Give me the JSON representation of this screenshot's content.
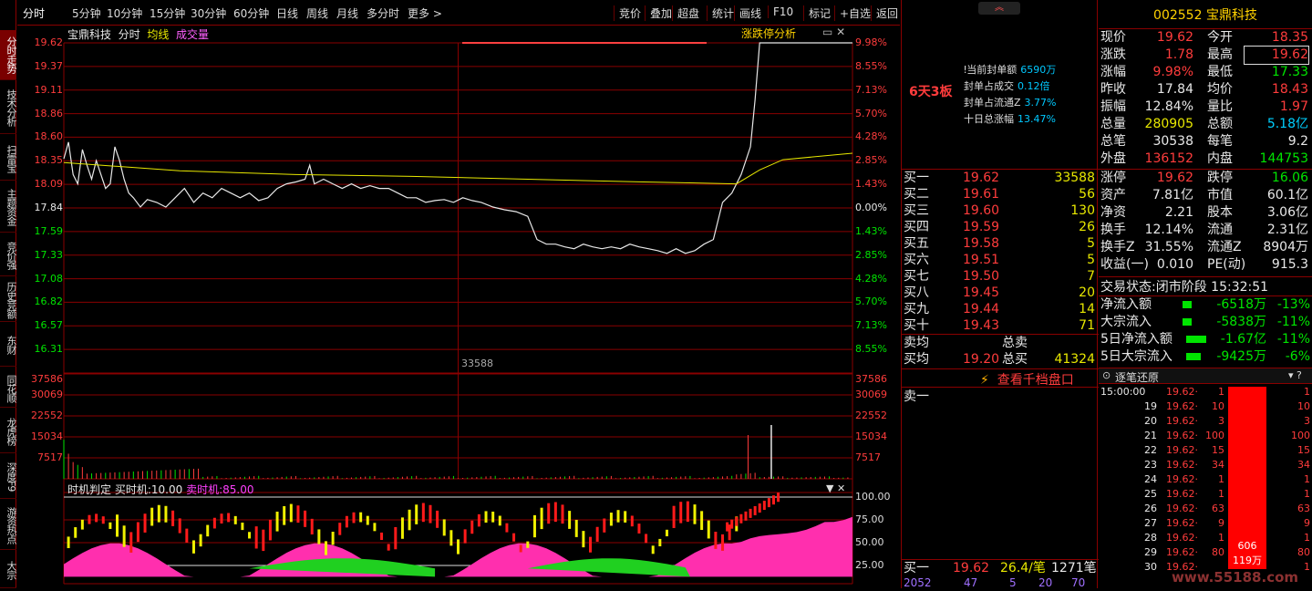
{
  "sidebar": [
    "分时走势",
    "技术分析",
    "扫雷宝",
    "主题资金",
    "竞价强",
    "历史竞额",
    "东财",
    "同花顺",
    "龙虎榜",
    "深度F9",
    "游资热点",
    "大宗"
  ],
  "topbar": {
    "tabs": [
      "分时",
      "5分钟",
      "10分钟",
      "15分钟",
      "30分钟",
      "60分钟",
      "日线",
      "周线",
      "月线",
      "多分时",
      "更多 >"
    ],
    "right": [
      "竞价",
      "叠加",
      "超盘",
      "统计",
      "画线",
      "F10",
      "标记",
      "+自选",
      "返回"
    ]
  },
  "chart": {
    "stock": "宝鼎科技",
    "mode": "分时",
    "ma": "均线",
    "vol": "成交量",
    "tool": "涨跌停分析",
    "prices": [
      "19.62",
      "19.37",
      "19.11",
      "18.86",
      "18.60",
      "18.35",
      "18.09",
      "17.84",
      "17.59",
      "17.33",
      "17.08",
      "16.82",
      "16.57",
      "16.31"
    ],
    "pcts": [
      "9.98%",
      "8.55%",
      "7.13%",
      "5.70%",
      "4.28%",
      "2.85%",
      "1.43%",
      "0.00%",
      "1.43%",
      "2.85%",
      "4.28%",
      "5.70%",
      "7.13%",
      "8.55%"
    ],
    "vol_labels": [
      "37586",
      "30069",
      "22552",
      "15034",
      "7517"
    ],
    "vol_marker": "33588",
    "ind_title": "时机判定",
    "ind_buy_label": "买时机:",
    "ind_buy": "10.00",
    "ind_sell_label": "卖时机:",
    "ind_sell": "85.00",
    "ind_labels": [
      "100.00",
      "75.00",
      "50.00",
      "25.00"
    ]
  },
  "chart_data": {
    "type": "line",
    "title": "宝鼎科技 分时",
    "prev_close": 17.84,
    "ylim": [
      16.06,
      19.62
    ],
    "price_series": [
      [
        0,
        18.37
      ],
      [
        2,
        18.55
      ],
      [
        4,
        18.2
      ],
      [
        6,
        18.1
      ],
      [
        8,
        18.47
      ],
      [
        10,
        18.3
      ],
      [
        12,
        18.15
      ],
      [
        14,
        18.35
      ],
      [
        16,
        18.2
      ],
      [
        18,
        18.05
      ],
      [
        20,
        18.1
      ],
      [
        22,
        18.5
      ],
      [
        24,
        18.35
      ],
      [
        26,
        18.15
      ],
      [
        28,
        18.0
      ],
      [
        30,
        17.95
      ],
      [
        33,
        17.85
      ],
      [
        36,
        17.93
      ],
      [
        40,
        17.9
      ],
      [
        44,
        17.85
      ],
      [
        48,
        17.95
      ],
      [
        52,
        18.05
      ],
      [
        56,
        17.9
      ],
      [
        60,
        18.0
      ],
      [
        64,
        17.95
      ],
      [
        68,
        18.05
      ],
      [
        72,
        18.0
      ],
      [
        76,
        17.95
      ],
      [
        80,
        18.0
      ],
      [
        84,
        17.92
      ],
      [
        88,
        17.95
      ],
      [
        92,
        18.05
      ],
      [
        96,
        18.1
      ],
      [
        100,
        18.12
      ],
      [
        104,
        18.15
      ],
      [
        106,
        18.3
      ],
      [
        108,
        18.1
      ],
      [
        112,
        18.15
      ],
      [
        116,
        18.1
      ],
      [
        120,
        18.05
      ],
      [
        124,
        18.1
      ],
      [
        128,
        18.05
      ],
      [
        132,
        18.08
      ],
      [
        136,
        18.05
      ],
      [
        140,
        18.05
      ],
      [
        144,
        18.0
      ],
      [
        148,
        17.95
      ],
      [
        152,
        17.95
      ],
      [
        156,
        17.9
      ],
      [
        160,
        17.92
      ],
      [
        164,
        17.93
      ],
      [
        168,
        17.9
      ],
      [
        172,
        17.95
      ],
      [
        176,
        17.92
      ],
      [
        180,
        17.9
      ],
      [
        185,
        17.85
      ],
      [
        190,
        17.82
      ],
      [
        195,
        17.8
      ],
      [
        200,
        17.75
      ],
      [
        204,
        17.5
      ],
      [
        208,
        17.45
      ],
      [
        212,
        17.45
      ],
      [
        216,
        17.42
      ],
      [
        220,
        17.4
      ],
      [
        224,
        17.45
      ],
      [
        228,
        17.42
      ],
      [
        232,
        17.4
      ],
      [
        236,
        17.42
      ],
      [
        240,
        17.4
      ],
      [
        244,
        17.45
      ],
      [
        248,
        17.42
      ],
      [
        252,
        17.4
      ],
      [
        256,
        17.38
      ],
      [
        260,
        17.35
      ],
      [
        264,
        17.4
      ],
      [
        268,
        17.35
      ],
      [
        272,
        17.38
      ],
      [
        276,
        17.45
      ],
      [
        280,
        17.5
      ],
      [
        284,
        17.9
      ],
      [
        288,
        18.0
      ],
      [
        292,
        18.2
      ],
      [
        296,
        18.5
      ],
      [
        298,
        19.0
      ],
      [
        300,
        19.62
      ],
      [
        320,
        19.62
      ],
      [
        340,
        19.62
      ]
    ],
    "avg_series": [
      [
        0,
        18.33
      ],
      [
        50,
        18.24
      ],
      [
        100,
        18.2
      ],
      [
        150,
        18.18
      ],
      [
        200,
        18.15
      ],
      [
        250,
        18.12
      ],
      [
        290,
        18.1
      ],
      [
        300,
        18.25
      ],
      [
        310,
        18.36
      ],
      [
        340,
        18.43
      ]
    ],
    "vol_peak": 33588
  },
  "mid": {
    "board": "6天3板",
    "seal": [
      [
        "当前封单额",
        "6590万"
      ],
      [
        "封单占成交",
        "0.12倍"
      ],
      [
        "封单占流通Z",
        "3.77%"
      ],
      [
        "十日总涨幅",
        "13.47%"
      ]
    ],
    "bids": [
      [
        "买一",
        "19.62",
        "33588"
      ],
      [
        "买二",
        "19.61",
        "56"
      ],
      [
        "买三",
        "19.60",
        "130"
      ],
      [
        "买四",
        "19.59",
        "26"
      ],
      [
        "买五",
        "19.58",
        "5"
      ],
      [
        "买六",
        "19.51",
        "5"
      ],
      [
        "买七",
        "19.50",
        "7"
      ],
      [
        "买八",
        "19.45",
        "20"
      ],
      [
        "买九",
        "19.44",
        "14"
      ],
      [
        "买十",
        "19.43",
        "71"
      ]
    ],
    "sell_avg_label": "卖均",
    "total_sell_label": "总卖",
    "buy_avg_label": "买均",
    "buy_avg": "19.20",
    "total_buy_label": "总买",
    "total_buy": "41324",
    "depth_link": "查看千档盘口",
    "sell1": "卖一",
    "bottom": {
      "label": "买一",
      "price": "19.62",
      "ratio": "26.4/笔",
      "trades": "1271笔"
    },
    "bottom2": [
      "2052",
      "47",
      "5",
      "20",
      "70"
    ]
  },
  "right": {
    "code": "002552",
    "name": "宝鼎科技",
    "quote": [
      [
        "现价",
        "19.62",
        "今开",
        "18.35"
      ],
      [
        "涨跌",
        "1.78",
        "最高",
        "19.62"
      ],
      [
        "涨幅",
        "9.98%",
        "最低",
        "17.33"
      ],
      [
        "昨收",
        "17.84",
        "均价",
        "18.43"
      ],
      [
        "振幅",
        "12.84%",
        "量比",
        "1.97"
      ],
      [
        "总量",
        "280905",
        "总额",
        "5.18亿"
      ],
      [
        "总笔",
        "30538",
        "每笔",
        "9.2"
      ],
      [
        "外盘",
        "136152",
        "内盘",
        "144753"
      ]
    ],
    "fund": [
      [
        "涨停",
        "19.62",
        "跌停",
        "16.06"
      ],
      [
        "资产",
        "7.81亿",
        "市值",
        "60.1亿"
      ],
      [
        "净资",
        "2.21",
        "股本",
        "3.06亿"
      ],
      [
        "换手",
        "12.14%",
        "流通",
        "2.31亿"
      ],
      [
        "换手Z",
        "31.55%",
        "流通Z",
        "8904万"
      ],
      [
        "收益(一)",
        "0.010",
        "PE(动)",
        "915.3"
      ]
    ],
    "status_label": "交易状态:",
    "status": "闭市阶段",
    "status_time": "15:32:51",
    "flows": [
      [
        "净流入额",
        "-6518万",
        "-13%"
      ],
      [
        "大宗流入",
        "-5838万",
        "-11%"
      ],
      [
        "5日净流入额",
        "-1.67亿",
        "-11%"
      ],
      [
        "5日大宗流入",
        "-9425万",
        "-6%"
      ]
    ],
    "ticks_title": "逐笔还原",
    "ticks": [
      [
        "15:00:00",
        "19.62",
        "1",
        "1"
      ],
      [
        "19",
        "19.62",
        "10",
        "10"
      ],
      [
        "20",
        "19.62",
        "3",
        "3"
      ],
      [
        "21",
        "19.62",
        "100",
        "100"
      ],
      [
        "22",
        "19.62",
        "15",
        "15"
      ],
      [
        "23",
        "19.62",
        "34",
        "34"
      ],
      [
        "24",
        "19.62",
        "1",
        "1"
      ],
      [
        "25",
        "19.62",
        "1",
        "1"
      ],
      [
        "26",
        "19.62",
        "63",
        "63"
      ],
      [
        "27",
        "19.62",
        "9",
        "9"
      ],
      [
        "28",
        "19.62",
        "1",
        "1"
      ],
      [
        "29",
        "19.62",
        "80",
        "80"
      ],
      [
        "30",
        "19.62",
        "",
        "1"
      ]
    ],
    "tick_bar_top": "606",
    "tick_bar_bot": "119万"
  },
  "watermark": "www.55188.com"
}
